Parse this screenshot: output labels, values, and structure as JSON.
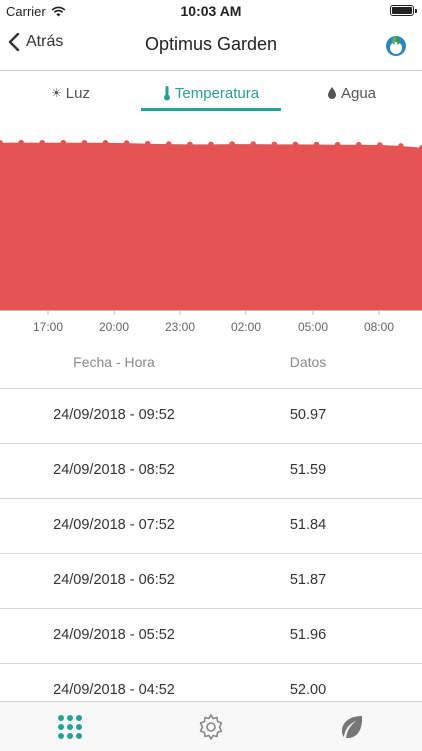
{
  "status": {
    "carrier": "Carrier",
    "time": "10:03 AM"
  },
  "nav": {
    "back_label": "Atrás",
    "title": "Optimus Garden"
  },
  "tabs": [
    {
      "label": "Luz",
      "icon": "sun-icon"
    },
    {
      "label": "Temperatura",
      "icon": "thermometer-icon",
      "active": true
    },
    {
      "label": "Agua",
      "icon": "water-drop-icon"
    }
  ],
  "colors": {
    "accent": "#27a193",
    "chart_fill": "#e55353"
  },
  "chart_data": {
    "type": "area",
    "x_tick_labels": [
      "17:00",
      "20:00",
      "23:00",
      "02:00",
      "05:00",
      "08:00"
    ],
    "series": [
      {
        "values": [
          52.5,
          52.55,
          52.5,
          52.55,
          52.5,
          52.5,
          52.4,
          52.2,
          52.1,
          52.0,
          52.0,
          52.1,
          52.1,
          52.0,
          52.0,
          51.95,
          51.9,
          51.9,
          51.8,
          51.5,
          50.97
        ]
      }
    ]
  },
  "table": {
    "headers": [
      "Fecha - Hora",
      "Datos"
    ],
    "rows": [
      {
        "datetime": "24/09/2018 - 09:52",
        "value": "50.97"
      },
      {
        "datetime": "24/09/2018 - 08:52",
        "value": "51.59"
      },
      {
        "datetime": "24/09/2018 - 07:52",
        "value": "51.84"
      },
      {
        "datetime": "24/09/2018 - 06:52",
        "value": "51.87"
      },
      {
        "datetime": "24/09/2018 - 05:52",
        "value": "51.96"
      },
      {
        "datetime": "24/09/2018 - 04:52",
        "value": "52.00"
      }
    ]
  },
  "tab_bar": [
    {
      "icon": "grid-icon",
      "active": true
    },
    {
      "icon": "gear-icon"
    },
    {
      "icon": "leaf-icon"
    }
  ]
}
